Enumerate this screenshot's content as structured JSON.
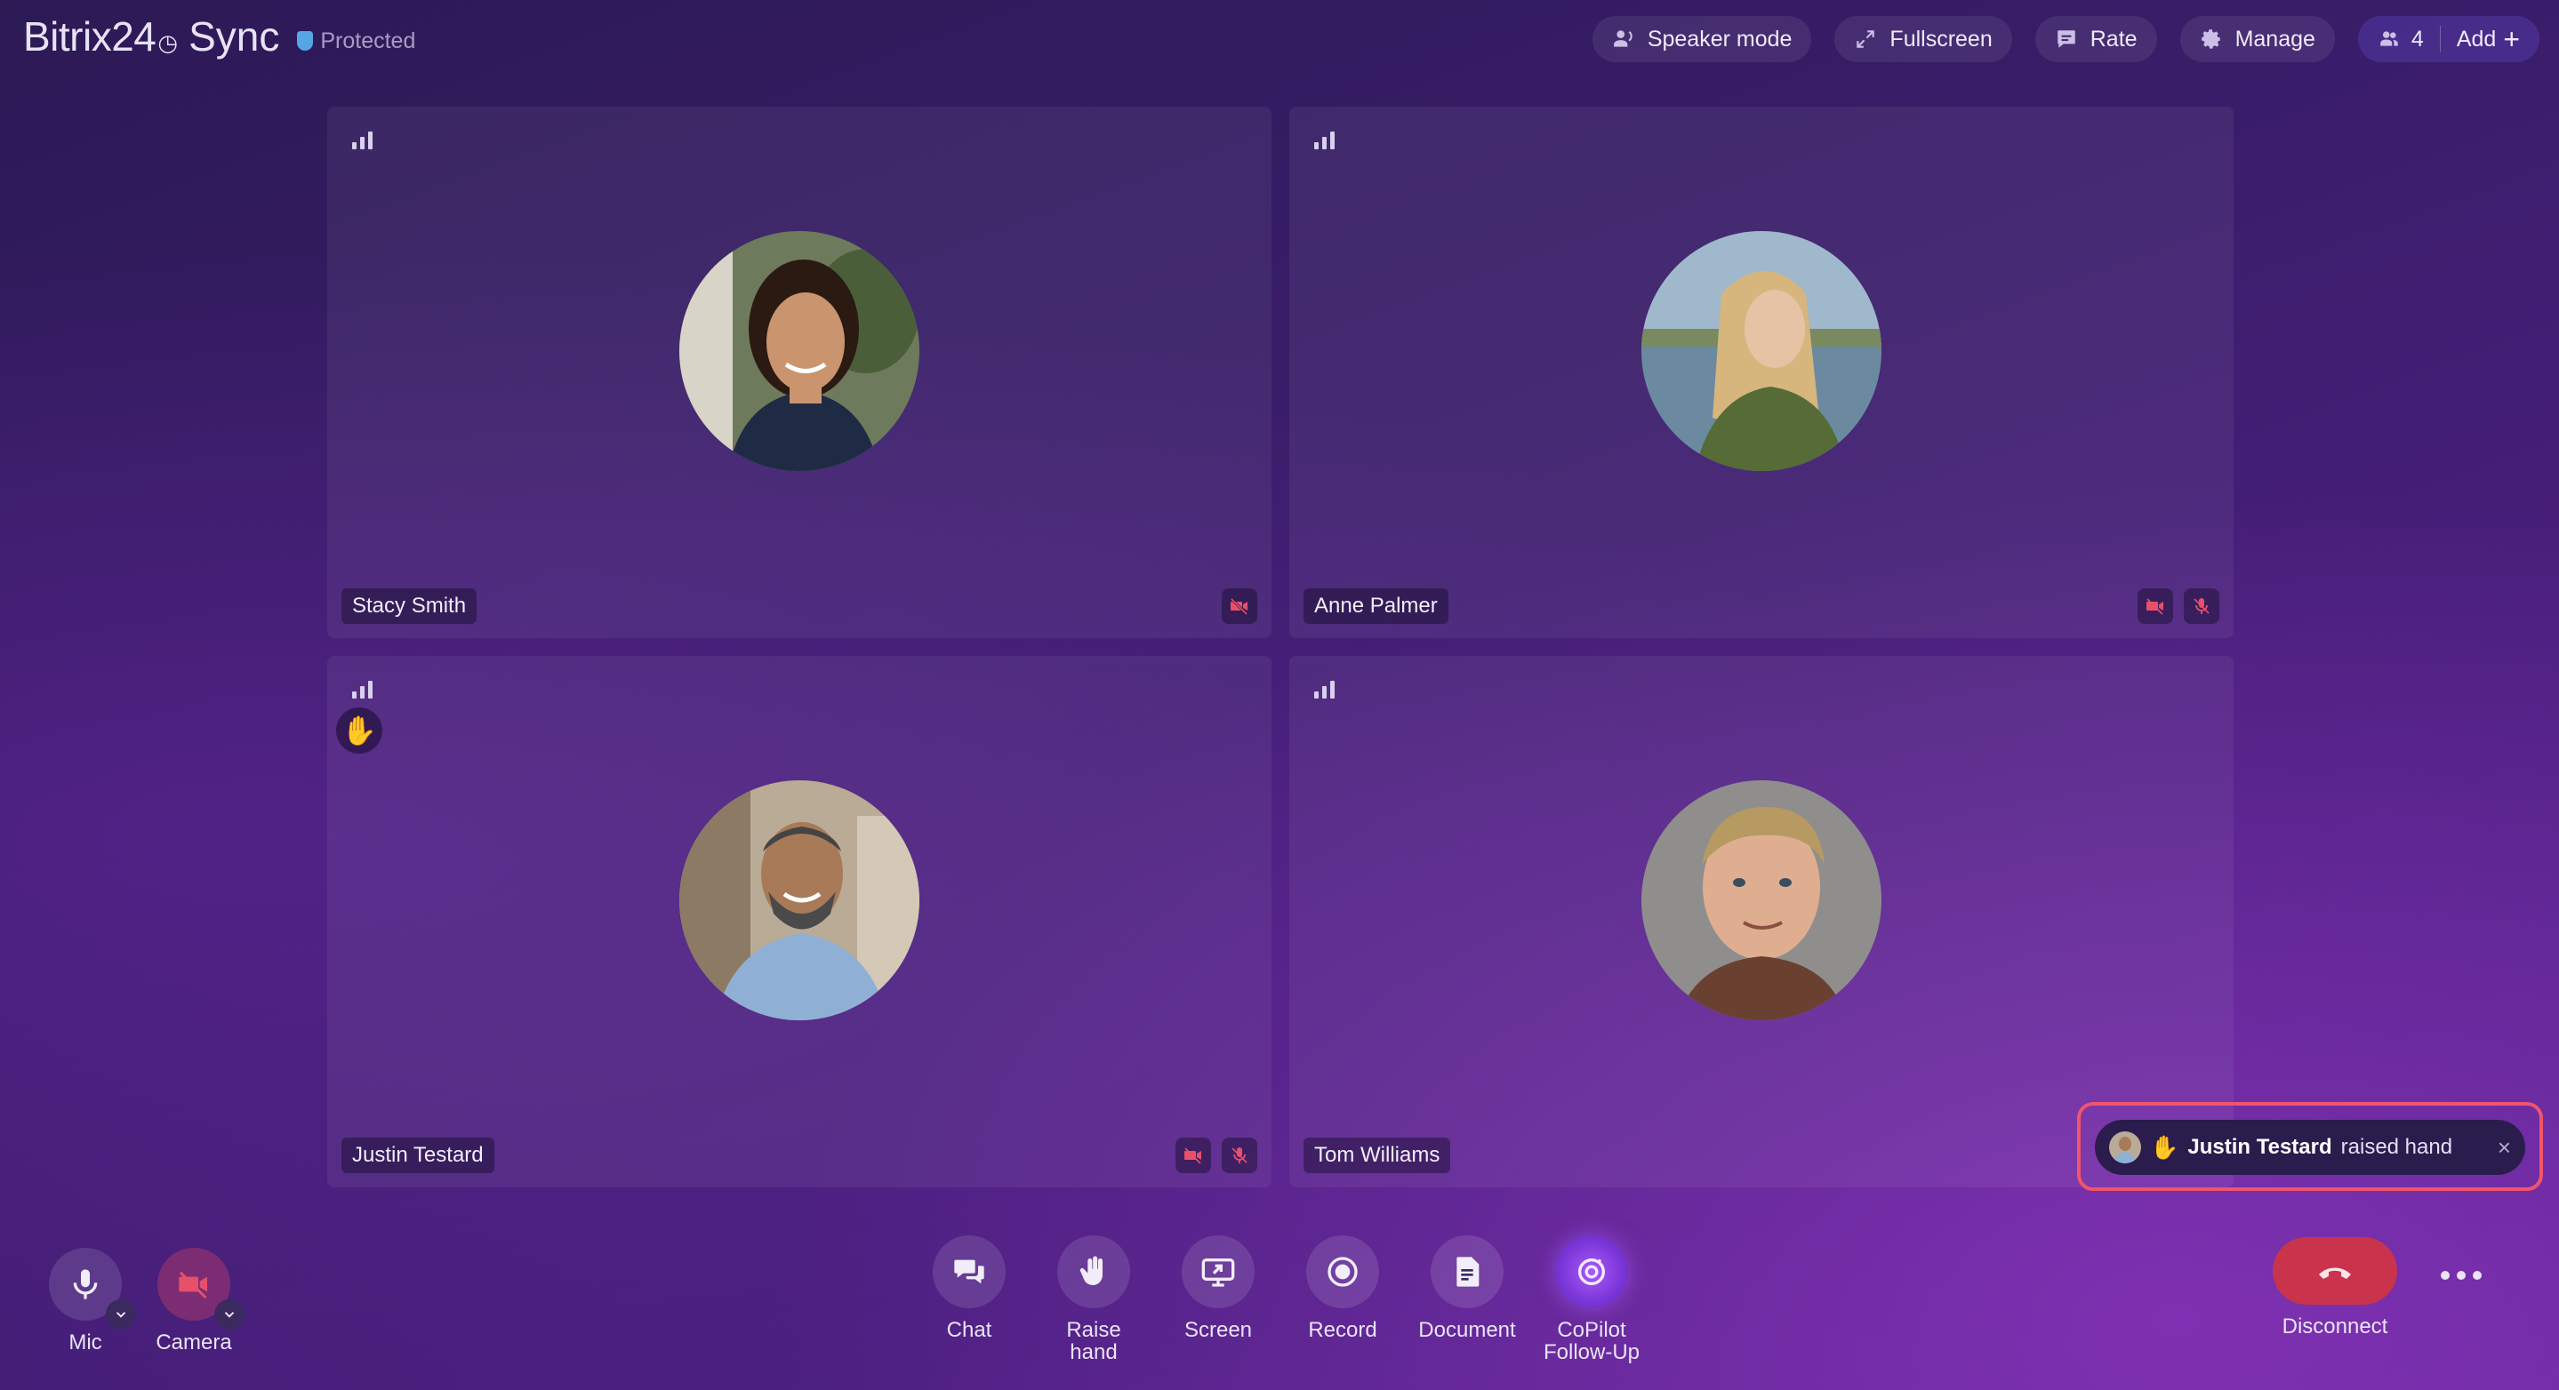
{
  "header": {
    "logo_brand": "Bitrix24",
    "logo_product": "Sync",
    "protected_label": "Protected",
    "actions": {
      "speaker_mode": "Speaker mode",
      "fullscreen": "Fullscreen",
      "rate": "Rate",
      "manage": "Manage",
      "participants_count": "4",
      "add": "Add"
    }
  },
  "participants": [
    {
      "name": "Stacy Smith",
      "camera_off": true,
      "mic_off": false,
      "raised_hand": false
    },
    {
      "name": "Anne Palmer",
      "camera_off": true,
      "mic_off": true,
      "raised_hand": false
    },
    {
      "name": "Justin Testard",
      "camera_off": true,
      "mic_off": true,
      "raised_hand": true
    },
    {
      "name": "Tom Williams",
      "camera_off": false,
      "mic_off": false,
      "raised_hand": false
    }
  ],
  "toast": {
    "name": "Justin Testard",
    "text": "raised hand",
    "close": "×"
  },
  "controls": {
    "mic": "Mic",
    "camera": "Camera",
    "chat": "Chat",
    "raise_hand_line1": "Raise",
    "raise_hand_line2": "hand",
    "screen": "Screen",
    "record": "Record",
    "document": "Document",
    "copilot_line1": "CoPilot",
    "copilot_line2": "Follow-Up",
    "disconnect": "Disconnect"
  },
  "colors": {
    "accent": "#7a35d8",
    "disconnect": "#c9344c",
    "toast_highlight": "#f2546b",
    "protected_shield": "#56a6e6"
  }
}
